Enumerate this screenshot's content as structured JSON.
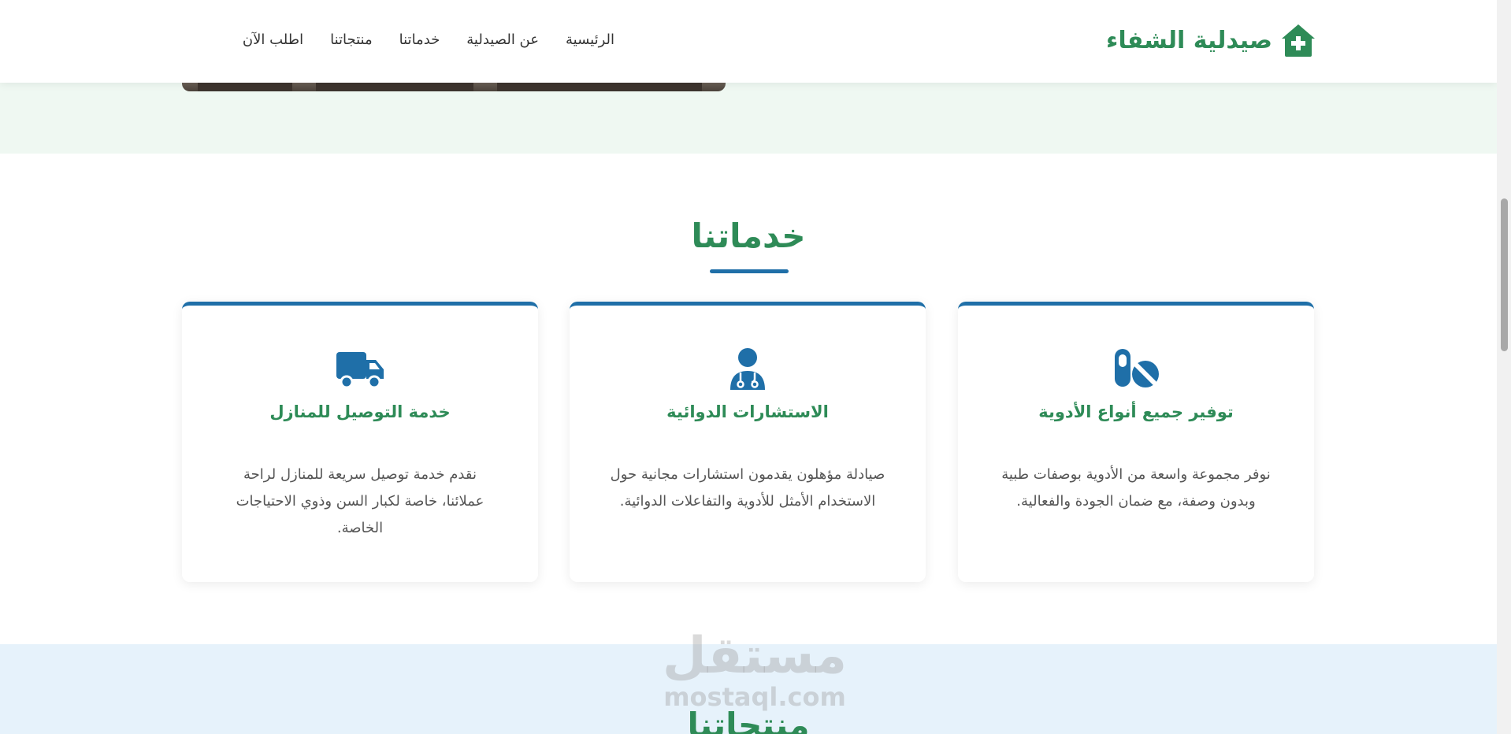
{
  "header": {
    "logo_text": "صيدلية الشفاء",
    "logo_icon": "house-medical-icon",
    "nav": [
      "الرئيسية",
      "عن الصيدلية",
      "خدماتنا",
      "منتجاتنا",
      "اطلب الآن"
    ]
  },
  "services": {
    "title": "خدماتنا",
    "cards": [
      {
        "icon": "pills-icon",
        "title": "توفير جميع أنواع الأدوية",
        "text": "نوفر مجموعة واسعة من الأدوية بوصفات طبية وبدون وصفة، مع ضمان الجودة والفعالية."
      },
      {
        "icon": "user-doctor-icon",
        "title": "الاستشارات الدوائية",
        "text": "صيادلة مؤهلون يقدمون استشارات مجانية حول الاستخدام الأمثل للأدوية والتفاعلات الدوائية."
      },
      {
        "icon": "truck-icon",
        "title": "خدمة التوصيل للمنازل",
        "text": "نقدم خدمة توصيل سريعة للمنازل لراحة عملائنا، خاصة لكبار السن وذوي الاحتياجات الخاصة."
      }
    ]
  },
  "products": {
    "title": "منتجاتنا"
  },
  "watermark": {
    "ar": "مستقل",
    "en": "mostaql.com"
  },
  "colors": {
    "green": "#2e8b57",
    "blue": "#1f6fa8",
    "hero_bg": "#eff8f2",
    "products_bg": "#e6f2fb"
  }
}
